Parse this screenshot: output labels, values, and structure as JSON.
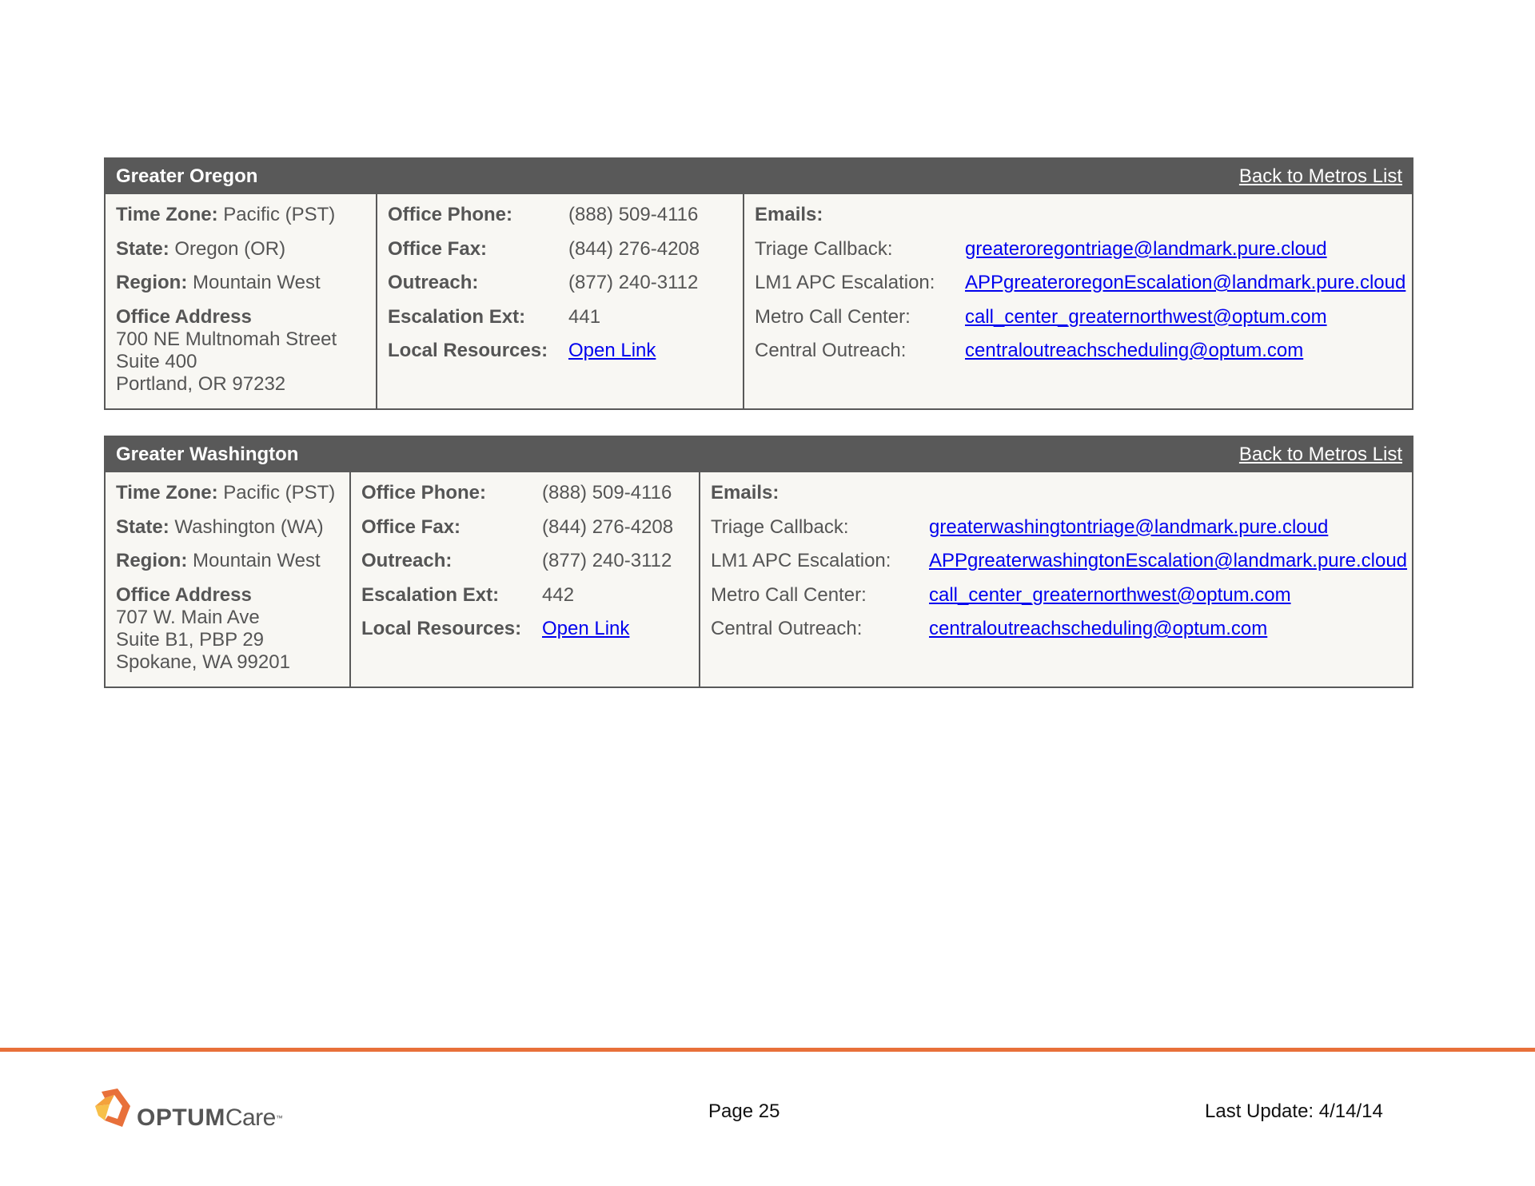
{
  "metros": [
    {
      "title": "Greater Oregon",
      "back_link": "Back to Metros List",
      "time_zone_label": "Time Zone:",
      "time_zone": "Pacific (PST)",
      "state_label": "State:",
      "state": "Oregon (OR)",
      "region_label": "Region:",
      "region": "Mountain West",
      "address_label": "Office Address",
      "address_lines": [
        "700 NE Multnomah Street",
        "Suite 400",
        "Portland, OR 97232"
      ],
      "contacts": [
        {
          "label": "Office Phone:",
          "value": "(888) 509-4116"
        },
        {
          "label": "Office Fax:",
          "value": "(844) 276-4208"
        },
        {
          "label": "Outreach:",
          "value": "(877) 240-3112"
        },
        {
          "label": "Escalation Ext:",
          "value": "441"
        },
        {
          "label": "Local Resources:",
          "value": "Open Link"
        }
      ],
      "emails_title": "Emails:",
      "emails": [
        {
          "label": "Triage Callback:",
          "value": "greateroregontriage@landmark.pure.cloud"
        },
        {
          "label": "LM1 APC Escalation:",
          "value": "APPgreateroregonEscalation@landmark.pure.cloud"
        },
        {
          "label": "Metro Call Center:",
          "value": "call_center_greaternorthwest@optum.com"
        },
        {
          "label": "Central Outreach:",
          "value": "centraloutreachscheduling@optum.com"
        }
      ]
    },
    {
      "title": "Greater Washington",
      "back_link": "Back to Metros List",
      "time_zone_label": "Time Zone:",
      "time_zone": "Pacific (PST)",
      "state_label": "State:",
      "state": "Washington (WA)",
      "region_label": "Region:",
      "region": "Mountain West",
      "address_label": "Office Address",
      "address_lines": [
        "707 W. Main Ave",
        "Suite B1, PBP 29",
        "Spokane, WA 99201"
      ],
      "contacts": [
        {
          "label": "Office Phone:",
          "value": "(888) 509-4116"
        },
        {
          "label": "Office Fax:",
          "value": "(844) 276-4208"
        },
        {
          "label": "Outreach:",
          "value": "(877) 240-3112"
        },
        {
          "label": "Escalation Ext:",
          "value": "442"
        },
        {
          "label": "Local Resources:",
          "value": "Open Link"
        }
      ],
      "emails_title": "Emails:",
      "emails": [
        {
          "label": "Triage Callback:",
          "value": "greaterwashingtontriage@landmark.pure.cloud"
        },
        {
          "label": "LM1 APC Escalation:",
          "value": "APPgreaterwashingtonEscalation@landmark.pure.cloud"
        },
        {
          "label": "Metro Call Center:",
          "value": "call_center_greaternorthwest@optum.com"
        },
        {
          "label": "Central Outreach:",
          "value": "centraloutreachscheduling@optum.com"
        }
      ]
    }
  ],
  "footer": {
    "logo_optum": "OPTUM",
    "logo_care": "Care",
    "logo_tm": "™",
    "logo_icon": "optum-logo-icon",
    "page": "Page 25",
    "last_update": "Last Update: 4/14/14",
    "rule_color": "#e8703a"
  },
  "colors": {
    "header_bg": "#595959",
    "panel_bg": "#f8f7f3",
    "link": "#0000ee"
  }
}
